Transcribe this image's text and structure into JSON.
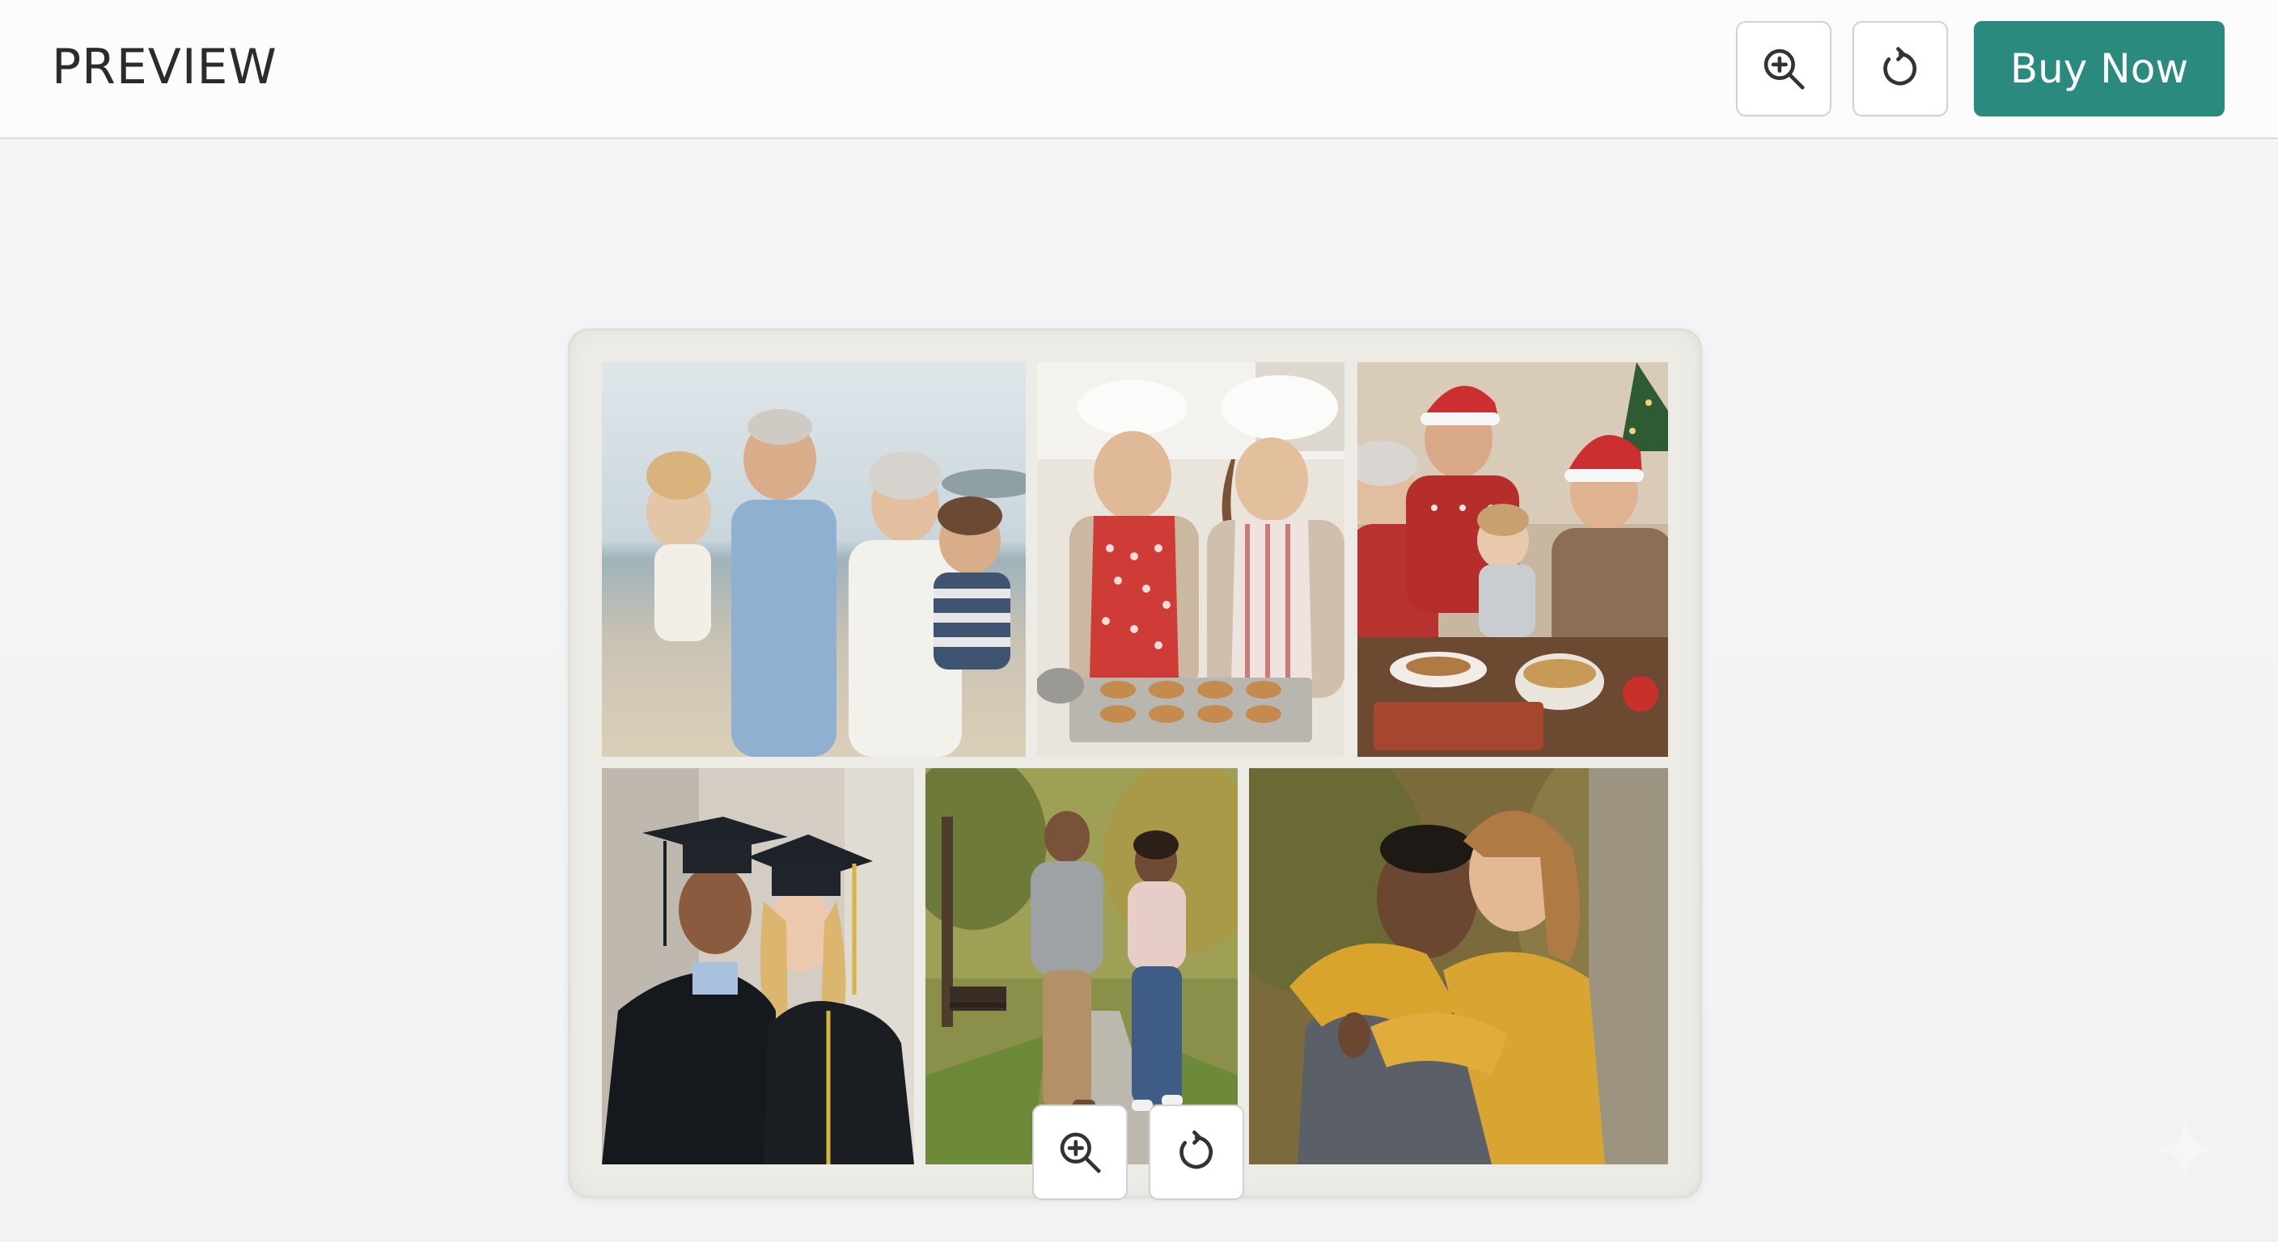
{
  "header": {
    "title": "PREVIEW",
    "buy_label": "Buy Now",
    "zoom_icon": "zoom-in-icon",
    "rotate_icon": "rotate-icon"
  },
  "colors": {
    "accent": "#2b8a7e",
    "background": "#f3f4f6",
    "header_bg": "#fcfcfc",
    "blanket": "#ecebe6"
  },
  "collage": {
    "photos": [
      {
        "subject": "grandparents-beach"
      },
      {
        "subject": "baking-cookies"
      },
      {
        "subject": "christmas-dinner"
      },
      {
        "subject": "graduation"
      },
      {
        "subject": "park-walk"
      },
      {
        "subject": "embrace"
      }
    ]
  },
  "bottom_toolbar": {
    "zoom_icon": "zoom-in-icon",
    "rotate_icon": "rotate-icon"
  }
}
